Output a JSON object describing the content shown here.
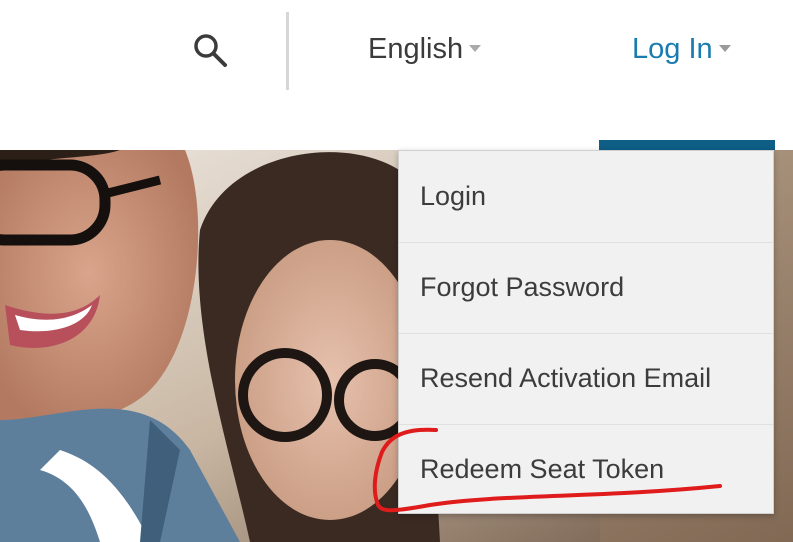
{
  "header": {
    "search_icon": "search-icon",
    "language": {
      "label": "English",
      "icon": "chevron-down-icon"
    },
    "login": {
      "label": "Log In",
      "icon": "chevron-down-icon"
    }
  },
  "dropdown": {
    "items": [
      {
        "label": "Login"
      },
      {
        "label": "Forgot Password"
      },
      {
        "label": "Resend Activation Email"
      },
      {
        "label": "Redeem Seat Token"
      }
    ]
  },
  "colors": {
    "link_blue": "#1a7bb0",
    "active_bar": "#0e5e86",
    "annotation_red": "#e01b1b",
    "muted_text": "#3b3b3b",
    "caret_gray": "#aaaaaa"
  }
}
